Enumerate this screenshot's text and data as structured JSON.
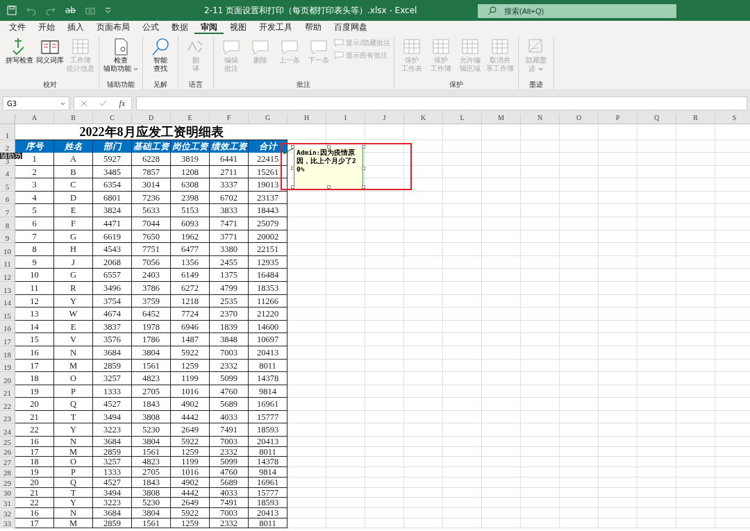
{
  "title_bar": {
    "quick_access_text": "ab",
    "title": "2-11 页面设置和打印（每页都打印表头等）.xlsx  -  Excel",
    "search": {
      "placeholder": "搜索(Alt+Q)"
    }
  },
  "tabs": [
    {
      "label": "文件",
      "selected": false
    },
    {
      "label": "开始",
      "selected": false
    },
    {
      "label": "插入",
      "selected": false
    },
    {
      "label": "页面布局",
      "selected": false
    },
    {
      "label": "公式",
      "selected": false
    },
    {
      "label": "数据",
      "selected": false
    },
    {
      "label": "审阅",
      "selected": true
    },
    {
      "label": "视图",
      "selected": false
    },
    {
      "label": "开发工具",
      "selected": false
    },
    {
      "label": "帮助",
      "selected": false
    },
    {
      "label": "百度网盘",
      "selected": false
    }
  ],
  "ribbon_groups": [
    {
      "name": "校对",
      "buttons": [
        {
          "kind": "large",
          "lines": [
            "拼写检查"
          ],
          "disabled": false,
          "dropdown": false
        },
        {
          "kind": "large",
          "lines": [
            "同义词库"
          ],
          "disabled": false,
          "dropdown": false
        },
        {
          "kind": "large",
          "lines": [
            "工作簿",
            "统计信息"
          ],
          "disabled": true,
          "dropdown": false
        }
      ]
    },
    {
      "name": "辅助功能",
      "buttons": [
        {
          "kind": "large",
          "lines": [
            "检查",
            "辅助功能"
          ],
          "disabled": false,
          "dropdown": true
        }
      ]
    },
    {
      "name": "见解",
      "buttons": [
        {
          "kind": "large",
          "lines": [
            "智能",
            "查找"
          ],
          "disabled": false,
          "dropdown": false
        }
      ]
    },
    {
      "name": "语言",
      "buttons": [
        {
          "kind": "large",
          "lines": [
            "翻",
            "译"
          ],
          "disabled": true,
          "dropdown": false
        }
      ]
    },
    {
      "name": "批注",
      "buttons": [
        {
          "kind": "large",
          "lines": [
            "编辑",
            "批注"
          ],
          "disabled": true,
          "dropdown": false
        },
        {
          "kind": "large",
          "lines": [
            "删除"
          ],
          "disabled": true,
          "dropdown": false
        },
        {
          "kind": "large",
          "lines": [
            "上一条"
          ],
          "disabled": true,
          "dropdown": false
        },
        {
          "kind": "large",
          "lines": [
            "下一条"
          ],
          "disabled": true,
          "dropdown": false
        },
        {
          "kind": "small",
          "lines": [
            "显示/隐藏批注"
          ],
          "disabled": true
        },
        {
          "kind": "small",
          "lines": [
            "显示所有批注"
          ],
          "disabled": true
        }
      ]
    },
    {
      "name": "保护",
      "buttons": [
        {
          "kind": "large",
          "lines": [
            "保护",
            "工作表"
          ],
          "disabled": true,
          "dropdown": false
        },
        {
          "kind": "large",
          "lines": [
            "保护",
            "工作簿"
          ],
          "disabled": true,
          "dropdown": false
        },
        {
          "kind": "large",
          "lines": [
            "允许编",
            "辑区域"
          ],
          "disabled": true,
          "dropdown": false
        },
        {
          "kind": "large",
          "lines": [
            "取消共",
            "享工作簿"
          ],
          "disabled": true,
          "dropdown": false
        }
      ]
    },
    {
      "name": "墨迹",
      "buttons": [
        {
          "kind": "large",
          "lines": [
            "隐藏墨",
            "迹"
          ],
          "disabled": true,
          "dropdown": true
        }
      ]
    }
  ],
  "formula_bar": {
    "name_box": "G3",
    "function_label": "fx"
  },
  "sheet": {
    "columns": [
      "A",
      "B",
      "C",
      "D",
      "E",
      "F",
      "G",
      "H",
      "I",
      "J",
      "K",
      "L",
      "M",
      "N",
      "O",
      "P",
      "Q",
      "R",
      "S"
    ],
    "title": "2022年8月应发工资明细表",
    "headers": [
      "序号",
      "姓名",
      "部门",
      "基础工资",
      "岗位工资",
      "绩效工资",
      "合计"
    ],
    "rows": [
      [
        "1",
        "A",
        "5927",
        "6228",
        "3819",
        "6441",
        "22415"
      ],
      [
        "2",
        "B",
        "3485",
        "7857",
        "1208",
        "2711",
        "15261"
      ],
      [
        "3",
        "C",
        "6354",
        "3014",
        "6308",
        "3337",
        "19013"
      ],
      [
        "4",
        "D",
        "6801",
        "7236",
        "2398",
        "6702",
        "23137"
      ],
      [
        "5",
        "E",
        "3824",
        "5633",
        "5153",
        "3833",
        "18443"
      ],
      [
        "6",
        "F",
        "4471",
        "7044",
        "6093",
        "7471",
        "25079"
      ],
      [
        "7",
        "G",
        "6619",
        "7650",
        "1962",
        "3771",
        "20002"
      ],
      [
        "8",
        "H",
        "4543",
        "7751",
        "6477",
        "3380",
        "22151"
      ],
      [
        "9",
        "J",
        "2068",
        "7056",
        "1356",
        "2455",
        "12935"
      ],
      [
        "10",
        "G",
        "6557",
        "2403",
        "6149",
        "1375",
        "16484"
      ],
      [
        "11",
        "R",
        "3496",
        "3786",
        "6272",
        "4799",
        "18353"
      ],
      [
        "12",
        "Y",
        "3754",
        "3759",
        "1218",
        "2535",
        "11266"
      ],
      [
        "13",
        "W",
        "4674",
        "6452",
        "7724",
        "2370",
        "21220"
      ],
      [
        "14",
        "E",
        "3837",
        "1978",
        "6946",
        "1839",
        "14600"
      ],
      [
        "15",
        "V",
        "3576",
        "1786",
        "1487",
        "3848",
        "10697"
      ],
      [
        "16",
        "N",
        "3684",
        "3804",
        "5922",
        "7003",
        "20413"
      ],
      [
        "17",
        "M",
        "2859",
        "1561",
        "1259",
        "2332",
        "8011"
      ],
      [
        "18",
        "O",
        "3257",
        "4823",
        "1199",
        "5099",
        "14378"
      ],
      [
        "19",
        "P",
        "1333",
        "2705",
        "1016",
        "4760",
        "9814"
      ],
      [
        "20",
        "Q",
        "4527",
        "1843",
        "4902",
        "5689",
        "16961"
      ],
      [
        "21",
        "T",
        "3494",
        "3808",
        "4442",
        "4033",
        "15777"
      ],
      [
        "22",
        "Y",
        "3223",
        "5230",
        "2649",
        "7491",
        "18593"
      ],
      [
        "16",
        "N",
        "3684",
        "3804",
        "5922",
        "7003",
        "20413"
      ],
      [
        "17",
        "M",
        "2859",
        "1561",
        "1259",
        "2332",
        "8011"
      ],
      [
        "18",
        "O",
        "3257",
        "4823",
        "1199",
        "5099",
        "14378"
      ],
      [
        "19",
        "P",
        "1333",
        "2705",
        "1016",
        "4760",
        "9814"
      ],
      [
        "20",
        "Q",
        "4527",
        "1843",
        "4902",
        "5689",
        "16961"
      ],
      [
        "21",
        "T",
        "3494",
        "3808",
        "4442",
        "4033",
        "15777"
      ],
      [
        "22",
        "Y",
        "3223",
        "5230",
        "2649",
        "7491",
        "18593"
      ],
      [
        "16",
        "N",
        "3684",
        "3804",
        "5922",
        "7003",
        "20413"
      ],
      [
        "17",
        "M",
        "2859",
        "1561",
        "1259",
        "2332",
        "8011"
      ]
    ],
    "row_numbers": [
      "1",
      "2",
      "3",
      "4",
      "5",
      "6",
      "7",
      "8",
      "9",
      "10",
      "11",
      "12",
      "13",
      "14",
      "15",
      "16",
      "17",
      "18",
      "19",
      "20",
      "21",
      "22",
      "23",
      "24",
      "25",
      "26",
      "27",
      "28",
      "29",
      "30",
      "31",
      "32",
      "33"
    ],
    "comment": {
      "text": "Admin:因为疫情原因，比上个月少了20%"
    },
    "tooltip": "辅助功"
  }
}
